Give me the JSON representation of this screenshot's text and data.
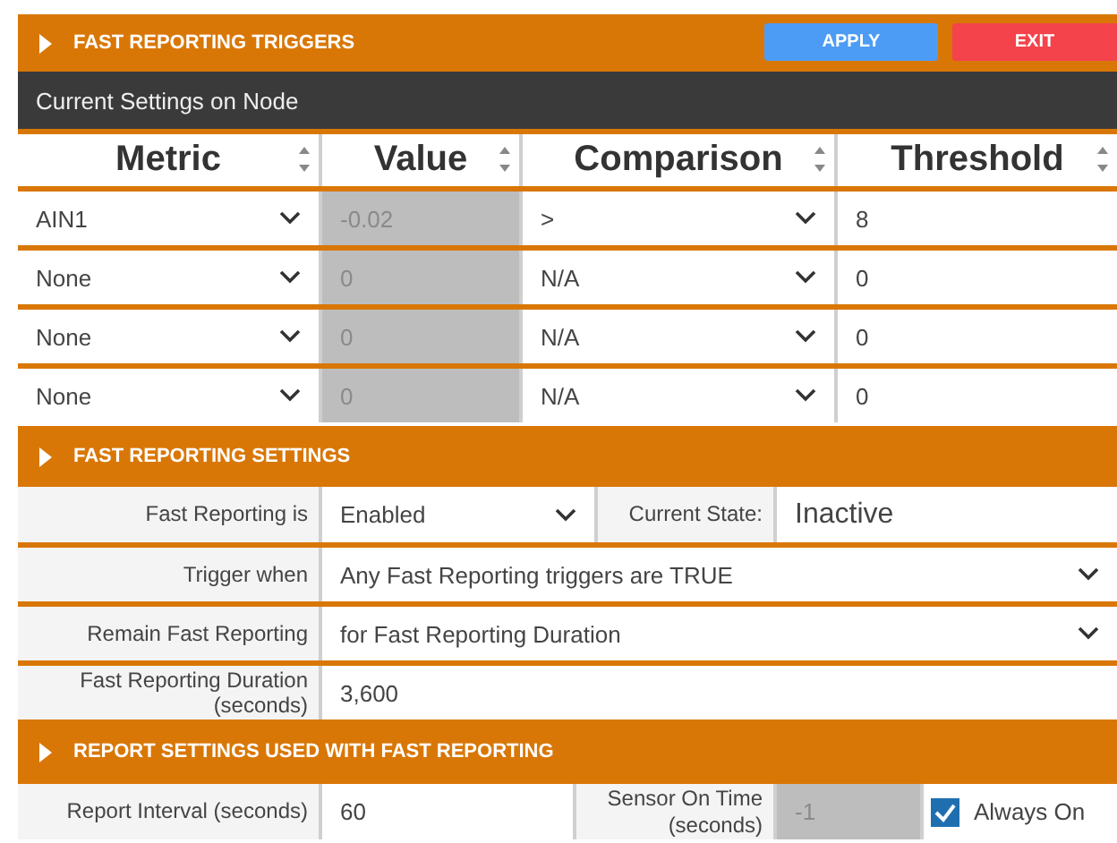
{
  "triggers": {
    "title": "FAST REPORTING TRIGGERS",
    "buttons": [
      {
        "label": "APPLY",
        "kind": "apply"
      },
      {
        "label": "EXIT",
        "kind": "exit"
      }
    ],
    "subtitle": "Current Settings on Node",
    "columns": [
      "Metric",
      "Value",
      "Comparison",
      "Threshold"
    ],
    "rows": [
      {
        "metric": "AIN1",
        "value": "-0.02",
        "value_disabled": true,
        "comparison": ">",
        "threshold": "8"
      },
      {
        "metric": "None",
        "value": "0",
        "value_disabled": true,
        "comparison": "N/A",
        "threshold": "0"
      },
      {
        "metric": "None",
        "value": "0",
        "value_disabled": true,
        "comparison": "N/A",
        "threshold": "0"
      },
      {
        "metric": "None",
        "value": "0",
        "value_disabled": true,
        "comparison": "N/A",
        "threshold": "0"
      }
    ]
  },
  "settings": {
    "title": "FAST REPORTING SETTINGS",
    "fast_reporting_is": {
      "label": "Fast Reporting is",
      "value": "Enabled"
    },
    "current_state": {
      "label": "Current State:",
      "value": "Inactive"
    },
    "rows": [
      {
        "label": "Trigger when",
        "value": "Any Fast Reporting triggers are TRUE",
        "kind": "select"
      },
      {
        "label": "Remain Fast Reporting",
        "value": "for Fast Reporting Duration",
        "kind": "select"
      },
      {
        "label": "Fast Reporting Duration (seconds)",
        "value": "3,600",
        "kind": "number"
      }
    ]
  },
  "report": {
    "title": "REPORT SETTINGS USED WITH FAST REPORTING",
    "interval": {
      "label": "Report Interval (seconds)",
      "value": "60"
    },
    "sensor_on_time": {
      "label": "Sensor On Time (seconds)",
      "value": "-1",
      "disabled": true
    },
    "always_on": {
      "label": "Always On",
      "checked": true
    }
  }
}
